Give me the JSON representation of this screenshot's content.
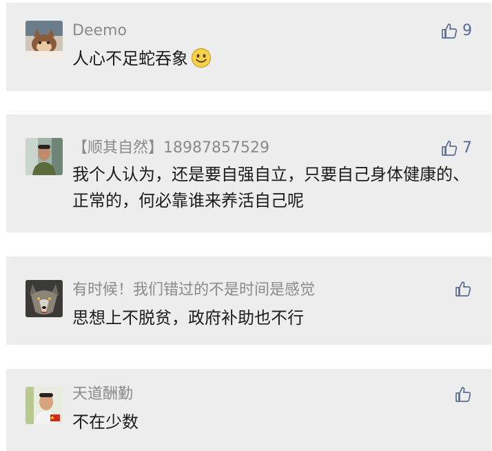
{
  "comments": [
    {
      "name": "Deemo",
      "text": "人心不足蛇吞象",
      "likes": "9",
      "has_emoji": true,
      "avatar_icon": "cartoon-cat-avatar"
    },
    {
      "name": "【顺其自然】18987857529",
      "text": "我个人认为，还是要自强自立，只要自己身体健康的、正常的，何必靠谁来养活自己呢",
      "likes": "7",
      "avatar_icon": "man-photo-avatar"
    },
    {
      "name": "有时候！我们错过的不是时间是感觉",
      "text": "思想上不脱贫，政府补助也不行",
      "likes": "",
      "avatar_icon": "wolf-avatar"
    },
    {
      "name": "天道酬勤",
      "text": "不在少数",
      "likes": "",
      "avatar_icon": "man-flag-avatar"
    }
  ],
  "colors": {
    "card_bg": "#ededed",
    "name": "#8a8a8a",
    "text": "#1b1b1b",
    "like": "#576b95"
  }
}
